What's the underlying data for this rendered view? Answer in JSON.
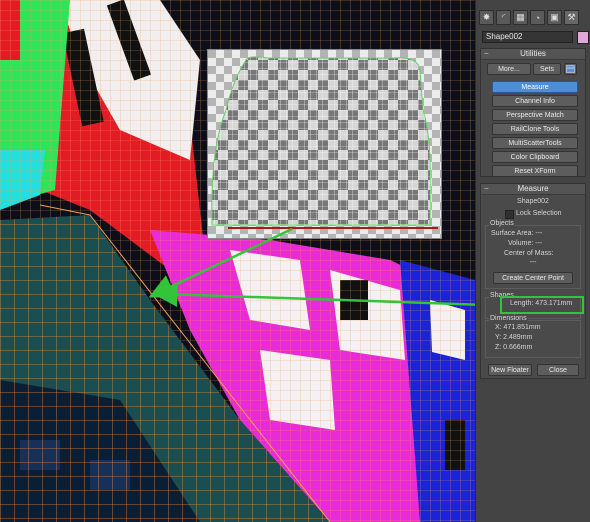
{
  "command_panel": {
    "tabs": [
      {
        "icon": "create-icon",
        "glyph": "✸"
      },
      {
        "icon": "modify-icon",
        "glyph": "◜"
      },
      {
        "icon": "hierarchy-icon",
        "glyph": "▦"
      },
      {
        "icon": "motion-icon",
        "glyph": "◔"
      },
      {
        "icon": "display-icon",
        "glyph": "▣"
      },
      {
        "icon": "utilities-icon",
        "glyph": "⚒"
      }
    ],
    "object_name": "Shape002",
    "object_color": "#e3a6d8"
  },
  "utilities": {
    "title": "Utilities",
    "more_label": "More...",
    "sets_label": "Sets",
    "items": [
      "Measure",
      "Channel Info",
      "Perspective Match",
      "RailClone Tools",
      "MultiScatterTools",
      "Color Clipboard",
      "Reset XForm"
    ],
    "active_item": "Measure"
  },
  "measure": {
    "title": "Measure",
    "object_name": "Shape002",
    "lock_selection": "Lock Selection",
    "objects_label": "Objects",
    "surface_area": "Surface Area:  ---",
    "volume": "Volume:  ---",
    "center_of_mass": "Center of Mass:",
    "center_value": "---",
    "create_center_point": "Create Center Point",
    "shapes_label": "Shapes",
    "length": "Length: 473.171mm",
    "dimensions_label": "Dimensions",
    "dim_x": "X:  471.851mm",
    "dim_y": "Y:  2.489mm",
    "dim_z": "Z:  0.666mm",
    "new_floater": "New Floater",
    "close": "Close"
  },
  "colors": {
    "highlight_green": "#33c43a",
    "active_button": "#4e8ed8"
  }
}
